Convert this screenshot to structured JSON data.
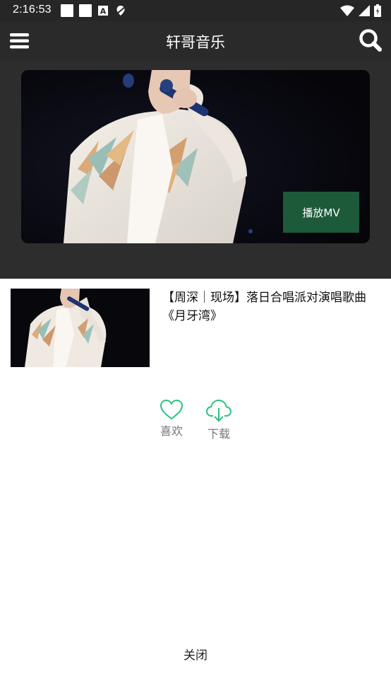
{
  "status_bar": {
    "time": "2:16:53",
    "left_icons": [
      "notification-square-icon",
      "notification-square-icon",
      "a-box-icon",
      "no-location-icon"
    ],
    "right_icons": [
      "wifi-icon",
      "signal-icon",
      "battery-icon"
    ]
  },
  "app_bar": {
    "title": "轩哥音乐",
    "menu_icon": "menu-icon",
    "search_icon": "search-icon"
  },
  "banner": {
    "play_mv_label": "播放MV"
  },
  "sheet": {
    "song_title": "【周深｜现场】落日合唱派对演唱歌曲《月牙湾》",
    "actions": [
      {
        "icon": "heart-icon",
        "label": "喜欢"
      },
      {
        "icon": "cloud-download-icon",
        "label": "下载"
      }
    ],
    "close_label": "关闭"
  },
  "colors": {
    "accent": "#2ec27e",
    "status_bar_bg": "#262626",
    "app_bar_bg": "#2a2a2a",
    "banner_bg": "#2d2d2d",
    "play_mv_bg": "#1d5a3a"
  }
}
